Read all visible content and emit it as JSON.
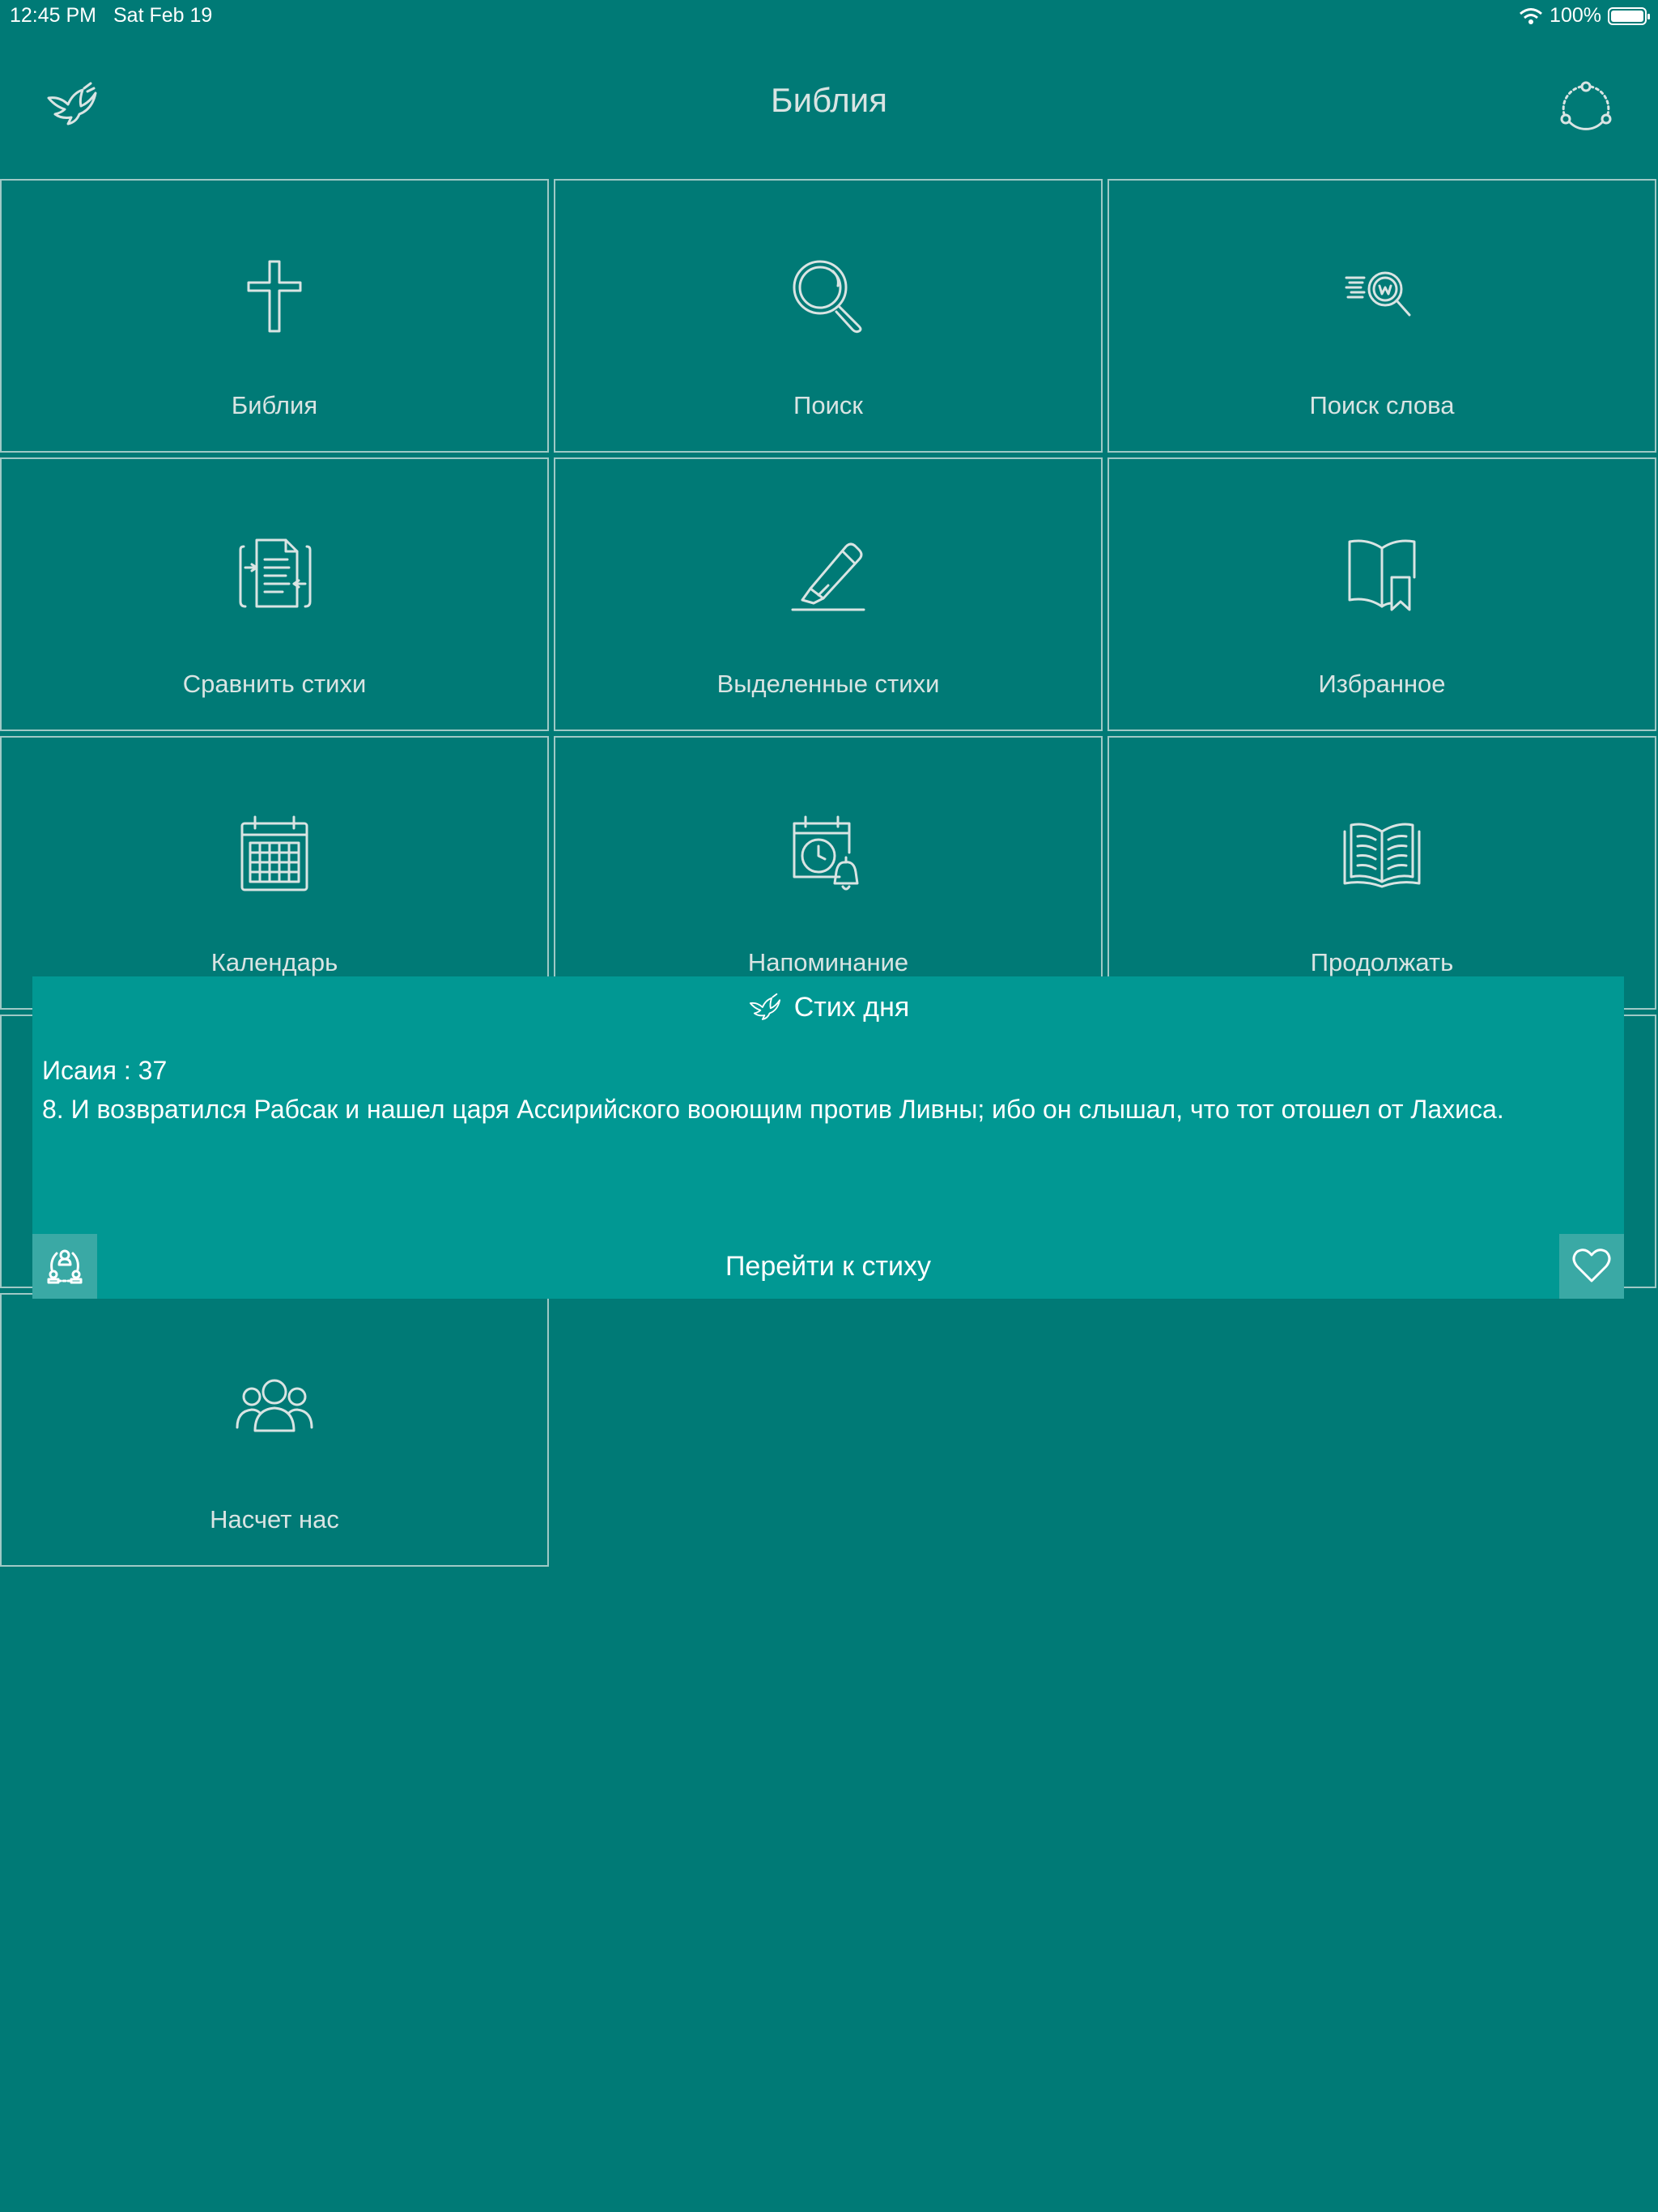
{
  "status_bar": {
    "time": "12:45 PM",
    "date": "Sat Feb 19",
    "battery": "100%",
    "wifi_icon": "wifi-icon",
    "battery_level": 1.0
  },
  "header": {
    "title": "Библия",
    "left_icon": "dove-icon",
    "right_icon": "share-icon"
  },
  "tiles": [
    {
      "label": "Библия",
      "icon": "cross-icon"
    },
    {
      "label": "Поиск",
      "icon": "search-icon"
    },
    {
      "label": "Поиск слова",
      "icon": "word-search-icon"
    },
    {
      "label": "Сравнить стихи",
      "icon": "compare-icon"
    },
    {
      "label": "Выделенные стихи",
      "icon": "highlighter-icon"
    },
    {
      "label": "Избранное",
      "icon": "bookmark-book-icon"
    },
    {
      "label": "Календарь",
      "icon": "calendar-icon"
    },
    {
      "label": "Напоминание",
      "icon": "reminder-icon"
    },
    {
      "label": "Продолжать",
      "icon": "open-book-icon"
    },
    {
      "label": "Насчет нас",
      "icon": "people-icon"
    }
  ],
  "verse_of_day": {
    "title": "Стих дня",
    "reference": "Исаия : 37",
    "text": "8. И возвратился Рабсак и нашел царя Ассирийского вооющим против Ливны; ибо он слышал, что тот отошел от Лахиса.",
    "go_label": "Перейти к стиху",
    "share_icon": "share-people-icon",
    "favorite_icon": "heart-icon"
  },
  "colors": {
    "background": "#007a76",
    "panel": "#019893",
    "tile_border": "#9fc9c6",
    "text": "#d9e4e3"
  }
}
